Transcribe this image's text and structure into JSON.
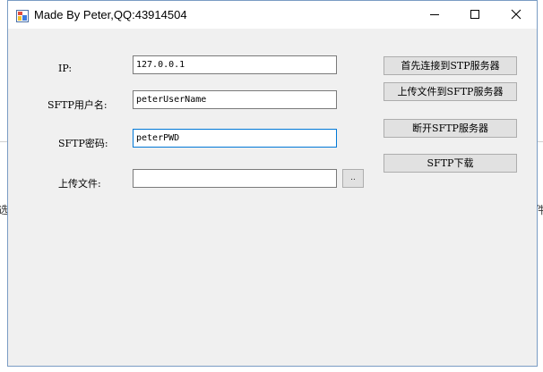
{
  "window": {
    "title": "Made By Peter,QQ:43914504"
  },
  "form": {
    "ip": {
      "label": "IP:",
      "value": "127.0.0.1"
    },
    "username": {
      "label": "SFTP用户名:",
      "value": "peterUserName"
    },
    "password": {
      "label": "SFTP密码:",
      "value": "peterPWD"
    },
    "upload_file": {
      "label": "上传文件:",
      "value": "",
      "browse_label": ".."
    }
  },
  "buttons": {
    "connect": "首先连接到STP服务器",
    "upload": "上传文件到SFTP服务器",
    "disconnect": "断开SFTP服务器",
    "download": "SFTP下载"
  },
  "background": {
    "left_glyph": "选",
    "right_glyph": "件"
  }
}
